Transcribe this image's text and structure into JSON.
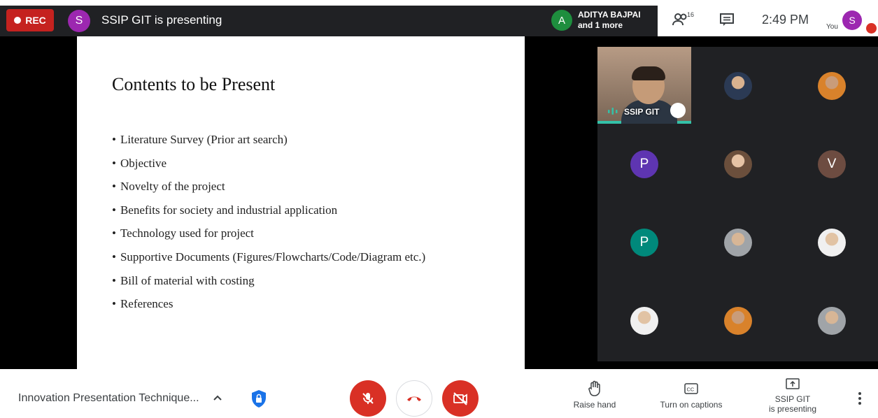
{
  "topbar": {
    "rec_label": "REC",
    "presenter_initial": "S",
    "presenting_text": "SSIP GIT is presenting",
    "speaker_initial": "A",
    "speaker_name": "ADITYA BAJPAI",
    "speaker_more": "and 1 more",
    "participant_count": "16",
    "time": "2:49 PM",
    "you_label": "You",
    "self_initial": "S"
  },
  "slide": {
    "title": "Contents to be Present",
    "bullets": [
      "Literature Survey (Prior art search)",
      "Objective",
      "Novelty of the project",
      "Benefits for society and industrial application",
      "Technology used for project",
      "Supportive Documents (Figures/Flowcharts/Code/Diagram etc.)",
      "Bill of material with costing",
      "References"
    ]
  },
  "tiles": {
    "featured_name": "SSIP GIT",
    "initials": [
      "P",
      "V",
      "P"
    ],
    "colors": {
      "purple": "#5e35b1",
      "brown": "#6d4c41",
      "teal": "#00897b",
      "green_active": "#33c1a8"
    }
  },
  "bottombar": {
    "meeting_title": "Innovation Presentation Technique...",
    "raise_hand": "Raise hand",
    "captions": "Turn on captions",
    "presenting_line1": "SSIP GIT",
    "presenting_line2": "is presenting"
  }
}
